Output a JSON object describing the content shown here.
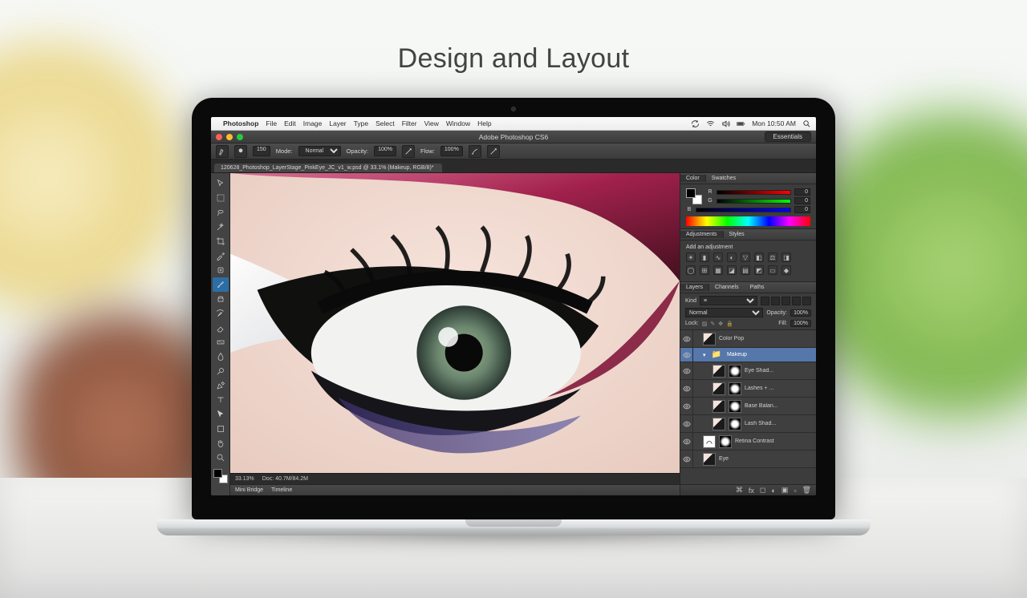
{
  "caption": "Design and Layout",
  "mac_menubar": {
    "app": "Photoshop",
    "items": [
      "File",
      "Edit",
      "Image",
      "Layer",
      "Type",
      "Select",
      "Filter",
      "View",
      "Window",
      "Help"
    ],
    "clock": "Mon 10:50 AM"
  },
  "app": {
    "title": "Adobe Photoshop CS6",
    "workspace": "Essentials",
    "document_tab": "120628_Photoshop_LayerStage_PinkEye_JC_v1_w.psd @ 33.1% (Makeup, RGB/8)*"
  },
  "options_bar": {
    "brush_size": "150",
    "mode_label": "Mode:",
    "mode_value": "Normal",
    "opacity_label": "Opacity:",
    "opacity_value": "100%",
    "flow_label": "Flow:",
    "flow_value": "100%"
  },
  "status_bar": {
    "zoom": "33.13%",
    "doc_info": "Doc: 40.7M/84.2M"
  },
  "bottom_tabs": {
    "mini_bridge": "Mini Bridge",
    "timeline": "Timeline"
  },
  "panels": {
    "color": {
      "tab_color": "Color",
      "tab_swatches": "Swatches",
      "r": "0",
      "g": "0",
      "b": "0"
    },
    "adjustments": {
      "tab_adj": "Adjustments",
      "tab_styles": "Styles",
      "label": "Add an adjustment"
    },
    "layers": {
      "tab_layers": "Layers",
      "tab_channels": "Channels",
      "tab_paths": "Paths",
      "kind_label": "Kind",
      "blend_mode": "Normal",
      "opacity_label": "Opacity:",
      "opacity_value": "100%",
      "lock_label": "Lock:",
      "fill_label": "Fill:",
      "fill_value": "100%",
      "items": [
        {
          "type": "layer",
          "name": "Color Pop",
          "indent": 0
        },
        {
          "type": "group",
          "name": "Makeup",
          "selected": true,
          "indent": 0
        },
        {
          "type": "layer",
          "name": "Eye Shad...",
          "indent": 1,
          "mask": true
        },
        {
          "type": "layer",
          "name": "Lashes + ...",
          "indent": 1,
          "mask": true
        },
        {
          "type": "layer",
          "name": "Base Balan...",
          "indent": 1,
          "mask": true
        },
        {
          "type": "layer",
          "name": "Lash Shad...",
          "indent": 1,
          "mask": true
        },
        {
          "type": "layer",
          "name": "Retina Contrast",
          "indent": 0,
          "mask": true,
          "adj": true
        },
        {
          "type": "layer",
          "name": "Eye",
          "indent": 0
        }
      ]
    }
  }
}
